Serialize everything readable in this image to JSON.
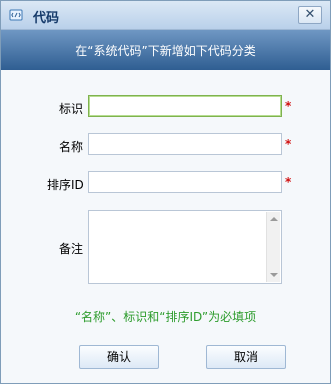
{
  "window": {
    "title": "代码",
    "close_symbol": "✕",
    "icons": [
      "code-app-icon",
      "close-icon",
      "scroll-up-icon",
      "scroll-down-icon"
    ]
  },
  "banner": {
    "text": "在“系统代码”下新增如下代码分类"
  },
  "form": {
    "fields": [
      {
        "label": "标识",
        "value": "",
        "required_mark": "*"
      },
      {
        "label": "名称",
        "value": "",
        "required_mark": "*"
      },
      {
        "label": "排序ID",
        "value": "",
        "required_mark": "*"
      },
      {
        "label": "备注",
        "value": ""
      }
    ],
    "hint": "“名称”、标识和“排序ID”为必填项"
  },
  "buttons": {
    "confirm": "确认",
    "cancel": "取消"
  },
  "colors": {
    "banner_top": "#6f97c3",
    "banner_bottom": "#2f5e92",
    "required": "#d01010",
    "hint": "#2d9c2d",
    "active_border": "#7fb24f"
  }
}
